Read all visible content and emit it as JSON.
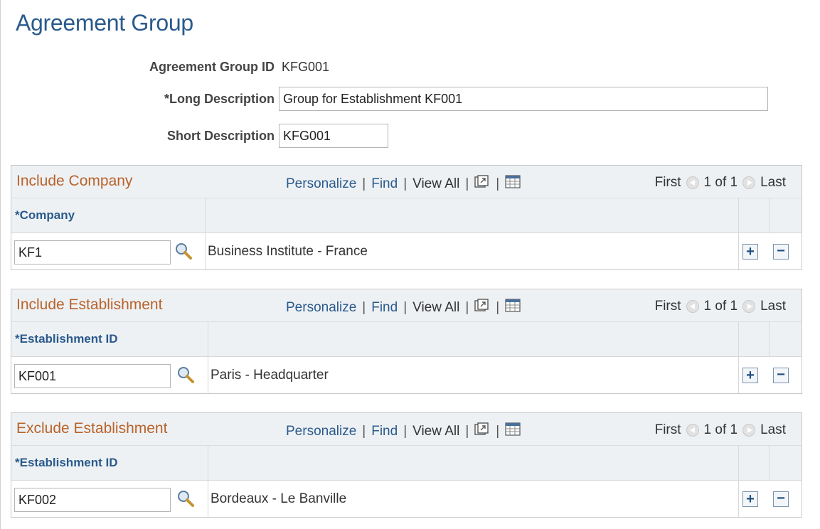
{
  "page": {
    "title": "Agreement Group"
  },
  "form": {
    "group_id_label": "Agreement Group ID",
    "group_id_value": "KFG001",
    "long_desc_label": "*Long Description",
    "long_desc_value": "Group for Establishment KF001",
    "short_desc_label": "Short Description",
    "short_desc_value": "KFG001"
  },
  "grid_nav": {
    "personalize": "Personalize",
    "find": "Find",
    "view_all": "View All",
    "separator": "|",
    "first": "First",
    "last": "Last",
    "count": "1 of 1",
    "icons": [
      "new-window-icon",
      "download-grid-icon",
      "first-page-arrow-icon",
      "last-page-arrow-icon"
    ]
  },
  "grids": [
    {
      "title": "Include Company",
      "column_label": "*Company",
      "rows": [
        {
          "key": "KF1",
          "description": "Business Institute - France"
        }
      ]
    },
    {
      "title": "Include Establishment",
      "column_label": "*Establishment ID",
      "rows": [
        {
          "key": "KF001",
          "description": "Paris - Headquarter"
        }
      ]
    },
    {
      "title": "Exclude Establishment",
      "column_label": "*Establishment ID",
      "rows": [
        {
          "key": "KF002",
          "description": "Bordeaux - Le Banville"
        }
      ]
    }
  ],
  "row_actions": {
    "add_symbol": "+",
    "delete_symbol": "−"
  },
  "colors": {
    "title_blue": "#2a5a8c",
    "grid_title_orange": "#b8632a",
    "grid_background": "#eef1f4"
  }
}
